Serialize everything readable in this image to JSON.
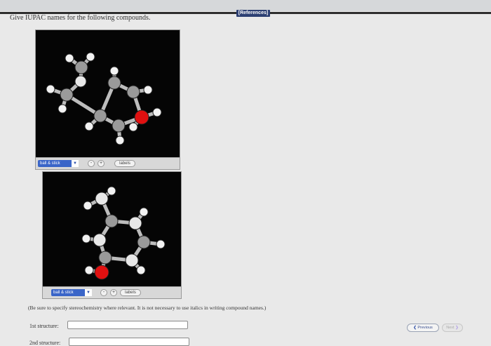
{
  "header": {
    "references_label": "[References]"
  },
  "prompt": "Give IUPAC names for the following compounds.",
  "viewers": [
    {
      "mode": "ball & stick",
      "zoom_out": "-",
      "zoom_in": "+",
      "labels": "labels"
    },
    {
      "mode": "ball & stick",
      "zoom_out": "-",
      "zoom_in": "+",
      "labels": "labels"
    }
  ],
  "note": "(Be sure to specify stereochemistry where relevant. It is not necessary to use italics in writing compound names.)",
  "answers": [
    {
      "label": "1st structure:",
      "value": ""
    },
    {
      "label": "2nd structure:",
      "value": ""
    }
  ],
  "nav": {
    "previous": "Previous",
    "next": "Next"
  },
  "colors": {
    "carbon": "#9a9a9a",
    "hydrogen": "#f2f2f2",
    "oxygen": "#e01010",
    "mode_select": "#3a65c8",
    "references": "#2c3f73"
  }
}
